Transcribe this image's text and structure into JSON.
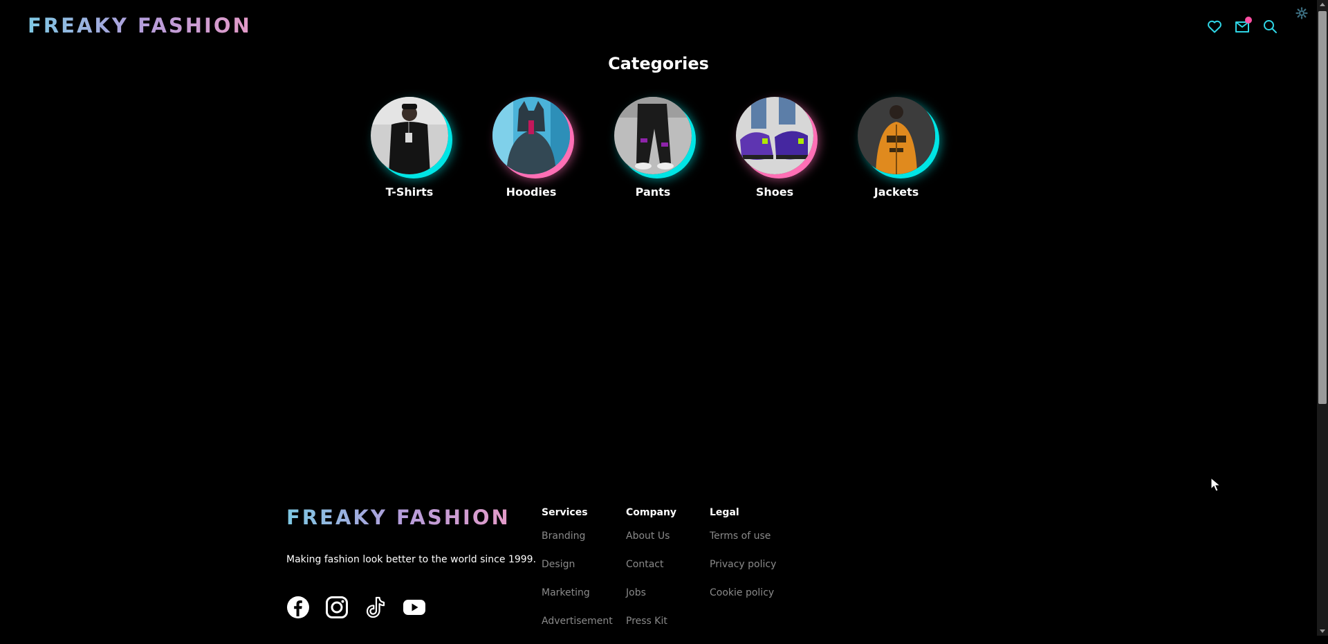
{
  "brand": {
    "name": "FREAKY FASHION"
  },
  "header": {
    "icons": [
      "heart-icon",
      "cart-icon",
      "search-icon"
    ],
    "cart_has_badge": true
  },
  "categories": {
    "title": "Categories",
    "items": [
      {
        "label": "T-Shirts",
        "accent": "#00e5e5"
      },
      {
        "label": "Hoodies",
        "accent": "#ff6fb5"
      },
      {
        "label": "Pants",
        "accent": "#00e5e5"
      },
      {
        "label": "Shoes",
        "accent": "#ff6fb5"
      },
      {
        "label": "Jackets",
        "accent": "#00e5e5"
      }
    ]
  },
  "footer": {
    "tagline": "Making fashion look better to the world since 1999.",
    "socials": [
      "facebook-icon",
      "instagram-icon",
      "tiktok-icon",
      "youtube-icon"
    ],
    "columns": [
      {
        "title": "Services",
        "links": [
          "Branding",
          "Design",
          "Marketing",
          "Advertisement"
        ]
      },
      {
        "title": "Company",
        "links": [
          "About Us",
          "Contact",
          "Jobs",
          "Press Kit"
        ]
      },
      {
        "title": "Legal",
        "links": [
          "Terms of use",
          "Privacy policy",
          "Cookie policy"
        ]
      }
    ]
  },
  "colors": {
    "accent_cyan": "#00e5e5",
    "accent_pink": "#ff6fb5",
    "link_gray": "#8a8a8a",
    "background": "#000000"
  }
}
